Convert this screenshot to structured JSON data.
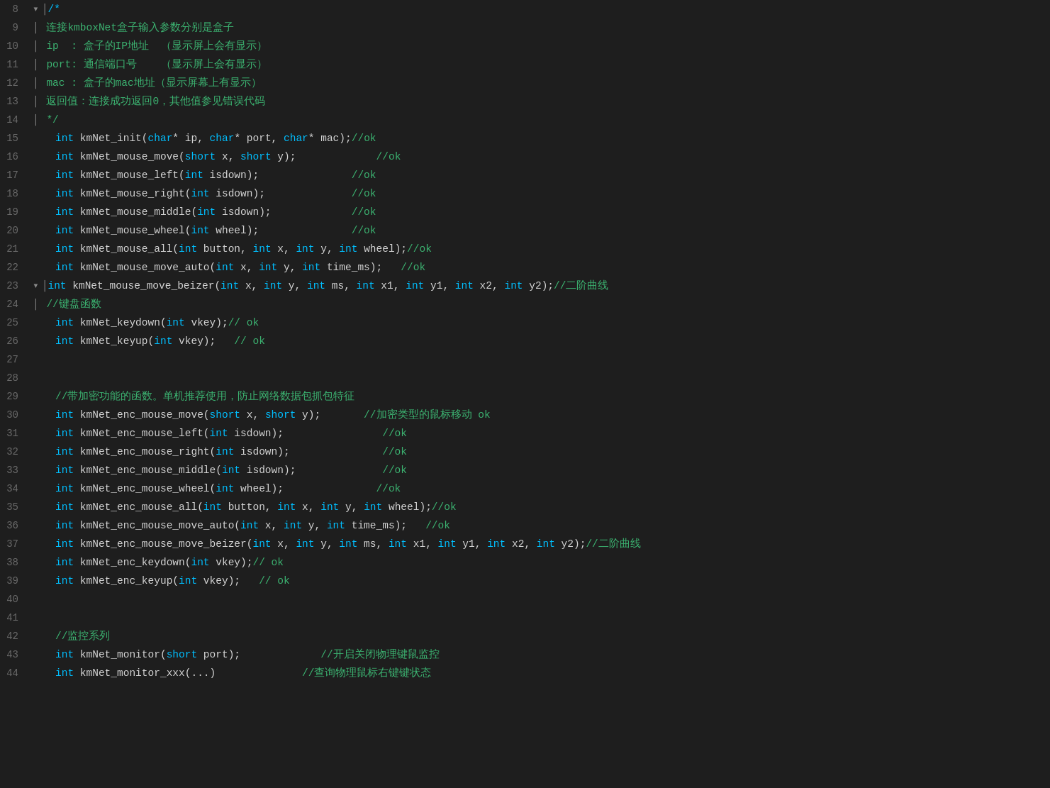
{
  "editor": {
    "background": "#1e1e1e",
    "lineHeight": 26,
    "lines": [
      {
        "num": "8",
        "fold": "v",
        "content": [
          {
            "t": "fold",
            "v": "v"
          },
          {
            "t": "kw",
            "v": "/*"
          }
        ]
      },
      {
        "num": "9",
        "indent": 4,
        "content": [
          {
            "t": "cm",
            "v": "| 连接kmboxNet盒子输入参数分别是盒子"
          }
        ]
      },
      {
        "num": "10",
        "indent": 4,
        "content": [
          {
            "t": "cm",
            "v": "| ip  : 盒子的IP地址  （显示屏上会有显示）"
          }
        ]
      },
      {
        "num": "11",
        "indent": 4,
        "content": [
          {
            "t": "cm",
            "v": "| port: 通信端口号    （显示屏上会有显示）"
          }
        ]
      },
      {
        "num": "12",
        "indent": 4,
        "content": [
          {
            "t": "cm",
            "v": "| mac : 盒子的mac地址（显示屏幕上有显示）"
          }
        ]
      },
      {
        "num": "13",
        "indent": 4,
        "content": [
          {
            "t": "cm",
            "v": "| 返回值：连接成功返回0，其他值参见错误代码"
          }
        ]
      },
      {
        "num": "14",
        "indent": 4,
        "content": [
          {
            "t": "cm",
            "v": "| */"
          }
        ]
      },
      {
        "num": "15",
        "indent": 4,
        "content": [
          {
            "t": "kw",
            "v": "int"
          },
          {
            "t": "normal",
            "v": " kmNet_init("
          },
          {
            "t": "kw",
            "v": "char"
          },
          {
            "t": "normal",
            "v": "* ip, "
          },
          {
            "t": "kw",
            "v": "char"
          },
          {
            "t": "normal",
            "v": "* port, "
          },
          {
            "t": "kw",
            "v": "char"
          },
          {
            "t": "normal",
            "v": "* mac);"
          },
          {
            "t": "cm",
            "v": "//ok"
          }
        ]
      },
      {
        "num": "16",
        "indent": 4,
        "content": [
          {
            "t": "kw",
            "v": "int"
          },
          {
            "t": "normal",
            "v": " kmNet_mouse_move("
          },
          {
            "t": "kw",
            "v": "short"
          },
          {
            "t": "normal",
            "v": " x, "
          },
          {
            "t": "kw",
            "v": "short"
          },
          {
            "t": "normal",
            "v": " y);             "
          },
          {
            "t": "cm",
            "v": "//ok"
          }
        ]
      },
      {
        "num": "17",
        "indent": 4,
        "content": [
          {
            "t": "kw",
            "v": "int"
          },
          {
            "t": "normal",
            "v": " kmNet_mouse_left("
          },
          {
            "t": "kw",
            "v": "int"
          },
          {
            "t": "normal",
            "v": " isdown);               "
          },
          {
            "t": "cm",
            "v": "//ok"
          }
        ]
      },
      {
        "num": "18",
        "indent": 4,
        "content": [
          {
            "t": "kw",
            "v": "int"
          },
          {
            "t": "normal",
            "v": " kmNet_mouse_right("
          },
          {
            "t": "kw",
            "v": "int"
          },
          {
            "t": "normal",
            "v": " isdown);              "
          },
          {
            "t": "cm",
            "v": "//ok"
          }
        ]
      },
      {
        "num": "19",
        "indent": 4,
        "content": [
          {
            "t": "kw",
            "v": "int"
          },
          {
            "t": "normal",
            "v": " kmNet_mouse_middle("
          },
          {
            "t": "kw",
            "v": "int"
          },
          {
            "t": "normal",
            "v": " isdown);             "
          },
          {
            "t": "cm",
            "v": "//ok"
          }
        ]
      },
      {
        "num": "20",
        "indent": 4,
        "content": [
          {
            "t": "kw",
            "v": "int"
          },
          {
            "t": "normal",
            "v": " kmNet_mouse_wheel("
          },
          {
            "t": "kw",
            "v": "int"
          },
          {
            "t": "normal",
            "v": " wheel);               "
          },
          {
            "t": "cm",
            "v": "//ok"
          }
        ]
      },
      {
        "num": "21",
        "indent": 4,
        "content": [
          {
            "t": "kw",
            "v": "int"
          },
          {
            "t": "normal",
            "v": " kmNet_mouse_all("
          },
          {
            "t": "kw",
            "v": "int"
          },
          {
            "t": "normal",
            "v": " button, "
          },
          {
            "t": "kw",
            "v": "int"
          },
          {
            "t": "normal",
            "v": " x, "
          },
          {
            "t": "kw",
            "v": "int"
          },
          {
            "t": "normal",
            "v": " y, "
          },
          {
            "t": "kw",
            "v": "int"
          },
          {
            "t": "normal",
            "v": " wheel);"
          },
          {
            "t": "cm",
            "v": "//ok"
          }
        ]
      },
      {
        "num": "22",
        "indent": 4,
        "content": [
          {
            "t": "kw",
            "v": "int"
          },
          {
            "t": "normal",
            "v": " kmNet_mouse_move_auto("
          },
          {
            "t": "kw",
            "v": "int"
          },
          {
            "t": "normal",
            "v": " x, "
          },
          {
            "t": "kw",
            "v": "int"
          },
          {
            "t": "normal",
            "v": " y, "
          },
          {
            "t": "kw",
            "v": "int"
          },
          {
            "t": "normal",
            "v": " time_ms);   "
          },
          {
            "t": "cm",
            "v": "//ok"
          }
        ]
      },
      {
        "num": "23",
        "fold": "v",
        "content": [
          {
            "t": "fold",
            "v": "v"
          },
          {
            "t": "kw",
            "v": "int"
          },
          {
            "t": "normal",
            "v": " kmNet_mouse_move_beizer("
          },
          {
            "t": "kw",
            "v": "int"
          },
          {
            "t": "normal",
            "v": " x, "
          },
          {
            "t": "kw",
            "v": "int"
          },
          {
            "t": "normal",
            "v": " y, "
          },
          {
            "t": "kw",
            "v": "int"
          },
          {
            "t": "normal",
            "v": " ms, "
          },
          {
            "t": "kw",
            "v": "int"
          },
          {
            "t": "normal",
            "v": " x1, "
          },
          {
            "t": "kw",
            "v": "int"
          },
          {
            "t": "normal",
            "v": " y1, "
          },
          {
            "t": "kw",
            "v": "int"
          },
          {
            "t": "normal",
            "v": " x2, "
          },
          {
            "t": "kw",
            "v": "int"
          },
          {
            "t": "normal",
            "v": " y2);"
          },
          {
            "t": "cm",
            "v": "//二阶曲线"
          }
        ]
      },
      {
        "num": "24",
        "indent": 4,
        "content": [
          {
            "t": "cm",
            "v": "| //键盘函数"
          }
        ]
      },
      {
        "num": "25",
        "indent": 4,
        "content": [
          {
            "t": "kw",
            "v": "int"
          },
          {
            "t": "normal",
            "v": " kmNet_keydown("
          },
          {
            "t": "kw",
            "v": "int"
          },
          {
            "t": "normal",
            "v": " vkey);"
          },
          {
            "t": "cm",
            "v": "// ok"
          }
        ]
      },
      {
        "num": "26",
        "indent": 4,
        "content": [
          {
            "t": "kw",
            "v": "int"
          },
          {
            "t": "normal",
            "v": " kmNet_keyup("
          },
          {
            "t": "kw",
            "v": "int"
          },
          {
            "t": "normal",
            "v": " vkey);   "
          },
          {
            "t": "cm",
            "v": "// ok"
          }
        ]
      },
      {
        "num": "27",
        "indent": 0,
        "content": []
      },
      {
        "num": "28",
        "indent": 0,
        "content": []
      },
      {
        "num": "29",
        "indent": 4,
        "content": [
          {
            "t": "cm",
            "v": "//带加密功能的函数。单机推荐使用，防止网络数据包抓包特征"
          }
        ]
      },
      {
        "num": "30",
        "indent": 4,
        "content": [
          {
            "t": "kw",
            "v": "int"
          },
          {
            "t": "normal",
            "v": " kmNet_enc_mouse_move("
          },
          {
            "t": "kw",
            "v": "short"
          },
          {
            "t": "normal",
            "v": " x, "
          },
          {
            "t": "kw",
            "v": "short"
          },
          {
            "t": "normal",
            "v": " y);       "
          },
          {
            "t": "cm",
            "v": "//加密类型的鼠标移动 ok"
          }
        ]
      },
      {
        "num": "31",
        "indent": 4,
        "content": [
          {
            "t": "kw",
            "v": "int"
          },
          {
            "t": "normal",
            "v": " kmNet_enc_mouse_left("
          },
          {
            "t": "kw",
            "v": "int"
          },
          {
            "t": "normal",
            "v": " isdown);                "
          },
          {
            "t": "cm",
            "v": "//ok"
          }
        ]
      },
      {
        "num": "32",
        "indent": 4,
        "content": [
          {
            "t": "kw",
            "v": "int"
          },
          {
            "t": "normal",
            "v": " kmNet_enc_mouse_right("
          },
          {
            "t": "kw",
            "v": "int"
          },
          {
            "t": "normal",
            "v": " isdown);               "
          },
          {
            "t": "cm",
            "v": "//ok"
          }
        ]
      },
      {
        "num": "33",
        "indent": 4,
        "content": [
          {
            "t": "kw",
            "v": "int"
          },
          {
            "t": "normal",
            "v": " kmNet_enc_mouse_middle("
          },
          {
            "t": "kw",
            "v": "int"
          },
          {
            "t": "normal",
            "v": " isdown);              "
          },
          {
            "t": "cm",
            "v": "//ok"
          }
        ]
      },
      {
        "num": "34",
        "indent": 4,
        "content": [
          {
            "t": "kw",
            "v": "int"
          },
          {
            "t": "normal",
            "v": " kmNet_enc_mouse_wheel("
          },
          {
            "t": "kw",
            "v": "int"
          },
          {
            "t": "normal",
            "v": " wheel);               "
          },
          {
            "t": "cm",
            "v": "//ok"
          }
        ]
      },
      {
        "num": "35",
        "indent": 4,
        "content": [
          {
            "t": "kw",
            "v": "int"
          },
          {
            "t": "normal",
            "v": " kmNet_enc_mouse_all("
          },
          {
            "t": "kw",
            "v": "int"
          },
          {
            "t": "normal",
            "v": " button, "
          },
          {
            "t": "kw",
            "v": "int"
          },
          {
            "t": "normal",
            "v": " x, "
          },
          {
            "t": "kw",
            "v": "int"
          },
          {
            "t": "normal",
            "v": " y, "
          },
          {
            "t": "kw",
            "v": "int"
          },
          {
            "t": "normal",
            "v": " wheel);"
          },
          {
            "t": "cm",
            "v": "//ok"
          }
        ]
      },
      {
        "num": "36",
        "indent": 4,
        "content": [
          {
            "t": "kw",
            "v": "int"
          },
          {
            "t": "normal",
            "v": " kmNet_enc_mouse_move_auto("
          },
          {
            "t": "kw",
            "v": "int"
          },
          {
            "t": "normal",
            "v": " x, "
          },
          {
            "t": "kw",
            "v": "int"
          },
          {
            "t": "normal",
            "v": " y, "
          },
          {
            "t": "kw",
            "v": "int"
          },
          {
            "t": "normal",
            "v": " time_ms);   "
          },
          {
            "t": "cm",
            "v": "//ok"
          }
        ]
      },
      {
        "num": "37",
        "indent": 4,
        "content": [
          {
            "t": "kw",
            "v": "int"
          },
          {
            "t": "normal",
            "v": " kmNet_enc_mouse_move_beizer("
          },
          {
            "t": "kw",
            "v": "int"
          },
          {
            "t": "normal",
            "v": " x, "
          },
          {
            "t": "kw",
            "v": "int"
          },
          {
            "t": "normal",
            "v": " y, "
          },
          {
            "t": "kw",
            "v": "int"
          },
          {
            "t": "normal",
            "v": " ms, "
          },
          {
            "t": "kw",
            "v": "int"
          },
          {
            "t": "normal",
            "v": " x1, "
          },
          {
            "t": "kw",
            "v": "int"
          },
          {
            "t": "normal",
            "v": " y1, "
          },
          {
            "t": "kw",
            "v": "int"
          },
          {
            "t": "normal",
            "v": " x2, "
          },
          {
            "t": "kw",
            "v": "int"
          },
          {
            "t": "normal",
            "v": " y2);"
          },
          {
            "t": "cm",
            "v": "//二阶曲线"
          }
        ]
      },
      {
        "num": "38",
        "indent": 4,
        "content": [
          {
            "t": "kw",
            "v": "int"
          },
          {
            "t": "normal",
            "v": " kmNet_enc_keydown("
          },
          {
            "t": "kw",
            "v": "int"
          },
          {
            "t": "normal",
            "v": " vkey);"
          },
          {
            "t": "cm",
            "v": "// ok"
          }
        ]
      },
      {
        "num": "39",
        "indent": 4,
        "content": [
          {
            "t": "kw",
            "v": "int"
          },
          {
            "t": "normal",
            "v": " kmNet_enc_keyup("
          },
          {
            "t": "kw",
            "v": "int"
          },
          {
            "t": "normal",
            "v": " vkey);   "
          },
          {
            "t": "cm",
            "v": "// ok"
          }
        ]
      },
      {
        "num": "40",
        "indent": 0,
        "content": []
      },
      {
        "num": "41",
        "indent": 0,
        "content": []
      },
      {
        "num": "42",
        "indent": 4,
        "content": [
          {
            "t": "cm",
            "v": "//监控系列"
          }
        ]
      },
      {
        "num": "43",
        "indent": 4,
        "content": [
          {
            "t": "kw",
            "v": "int"
          },
          {
            "t": "normal",
            "v": " kmNet_monitor("
          },
          {
            "t": "kw",
            "v": "short"
          },
          {
            "t": "normal",
            "v": " port);             "
          },
          {
            "t": "cm",
            "v": "//开启关闭物理键鼠监控"
          }
        ]
      },
      {
        "num": "44",
        "indent": 4,
        "content": [
          {
            "t": "kw",
            "v": "int"
          },
          {
            "t": "normal",
            "v": " kmNet_monitor_xxx(...)              "
          },
          {
            "t": "cm",
            "v": "//查询物理鼠标右键键状态"
          }
        ]
      }
    ]
  }
}
